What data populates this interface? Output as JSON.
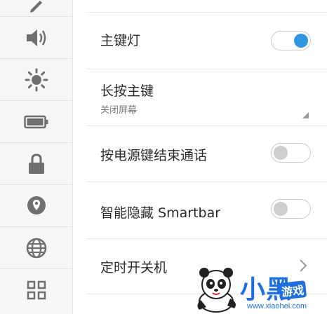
{
  "sidebar": {
    "items": [
      {
        "icon": "edit-icon"
      },
      {
        "icon": "speaker-icon"
      },
      {
        "icon": "brightness-icon"
      },
      {
        "icon": "battery-icon"
      },
      {
        "icon": "lock-icon"
      },
      {
        "icon": "location-icon"
      },
      {
        "icon": "globe-icon"
      },
      {
        "icon": "grid-icon"
      }
    ]
  },
  "settings": {
    "home_key_light": {
      "label": "主键灯",
      "enabled": true
    },
    "long_press_home": {
      "label": "长按主键",
      "value": "关闭屏幕"
    },
    "power_end_call": {
      "label": "按电源键结束通话",
      "enabled": false
    },
    "hide_smartbar": {
      "label": "智能隐藏 Smartbar",
      "enabled": false
    },
    "scheduled_power": {
      "label": "定时开关机"
    }
  },
  "watermark": {
    "brand": "小黑",
    "badge": "游戏",
    "url": "www.xiaohei.com"
  },
  "colors": {
    "accent": "#3196e0",
    "toggle_off_knob": "#cfcfcf",
    "watermark_blue": "#1f6fe0"
  }
}
